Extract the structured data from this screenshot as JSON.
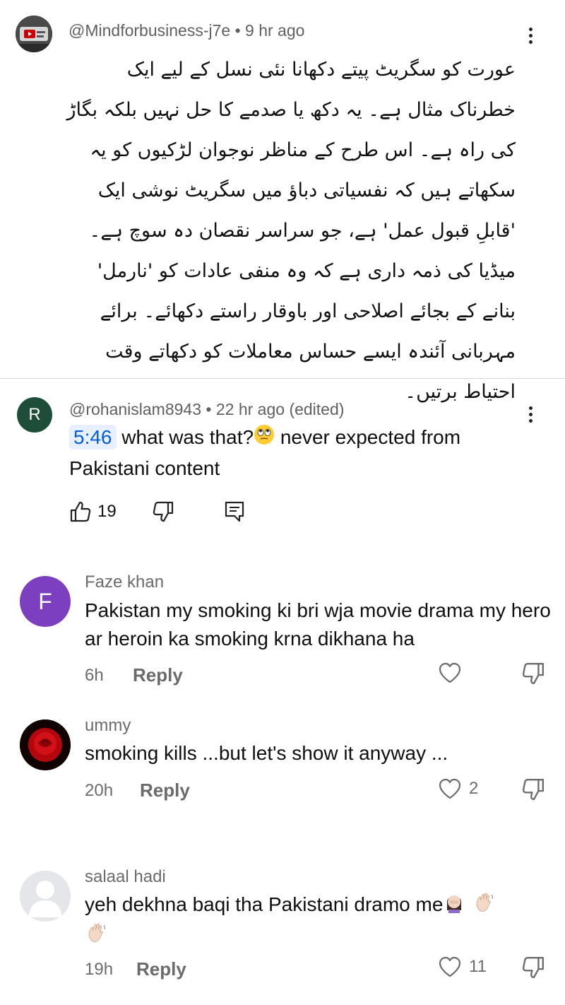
{
  "top_comment": {
    "handle": "@Mindforbusiness-j7e",
    "time": "9 hr ago",
    "paragraph1": "عورت کو سگریٹ پیتے دکھانا نئی نسل کے لیے ایک خطرناک مثال ہے۔ یہ دکھ یا صدمے کا حل نہیں بلکہ بگاڑ کی راہ ہے۔ اس طرح کے مناظر نوجوان لڑکیوں کو یہ سکھاتے ہیں کہ نفسیاتی دباؤ میں سگریٹ نوشی ایک 'قابلِ قبول عمل' ہے، جو سراسر نقصان دہ سوچ ہے۔",
    "paragraph2": "میڈیا کی ذمہ داری ہے کہ وہ منفی عادات کو 'نارمل' بنانے کے بجائے اصلاحی اور باوقار راستے دکھائے۔ برائے مہربانی آئندہ ایسے حساس معاملات کو دکھاتے وقت احتیاط برتیں۔"
  },
  "main_comment": {
    "avatar_letter": "R",
    "avatar_color": "#1e4d3a",
    "handle": "@rohanislam8943",
    "time": "22 hr ago (edited)",
    "timestamp_link": "5:46",
    "text_part1": " what was that?",
    "text_part2": " never expected from Pakistani content",
    "likes": "19"
  },
  "replies": [
    {
      "name": "Faze khan",
      "avatar_letter": "F",
      "avatar_color": "#7b3fbf",
      "text": "Pakistan my smoking ki bri wja movie drama my hero ar heroin ka smoking krna dikhana ha",
      "time": "6h",
      "reply_label": "Reply",
      "likes": ""
    },
    {
      "name": "ummy",
      "text": "smoking kills ...but let's show it anyway ...",
      "time": "20h",
      "reply_label": "Reply",
      "likes": "2"
    },
    {
      "name": "salaal hadi",
      "text": "yeh dekhna baqi tha Pakistani dramo me",
      "time": "19h",
      "reply_label": "Reply",
      "likes": "11"
    }
  ],
  "colors": {
    "link_blue": "#065fd4",
    "meta_gray": "#606060"
  }
}
